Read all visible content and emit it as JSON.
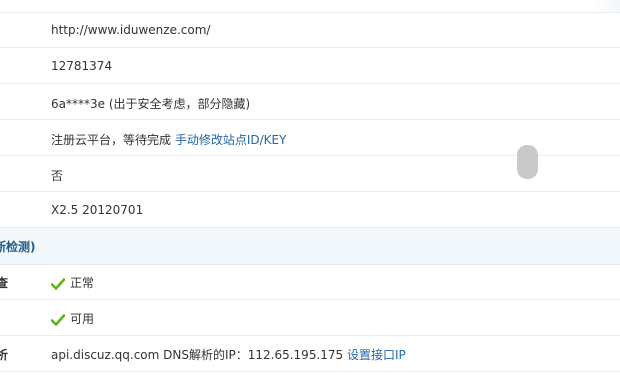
{
  "info_rows": [
    {
      "value": "http://www.iduwenze.com/"
    },
    {
      "value": "12781374"
    },
    {
      "value": "6a****3e (出于安全考虑，部分隐藏)"
    },
    {
      "value_prefix": "注册云平台，等待完成 ",
      "link": "手动修改站点ID/KEY"
    },
    {
      "value": "否"
    },
    {
      "value": "X2.5 20120701"
    }
  ],
  "section": {
    "title": "断检测)"
  },
  "check_rows": [
    {
      "label": "查",
      "status": "正常"
    },
    {
      "label": "：",
      "status": "可用"
    },
    {
      "label": "析",
      "value_prefix": "api.discuz.qq.com DNS解析的IP：112.65.195.175 ",
      "link": "设置接口IP"
    }
  ],
  "colors": {
    "link": "#2366a8",
    "check": "#5cb21a",
    "section_bg": "#f2f8fc"
  },
  "icons": {
    "check": "checkmark-icon"
  }
}
